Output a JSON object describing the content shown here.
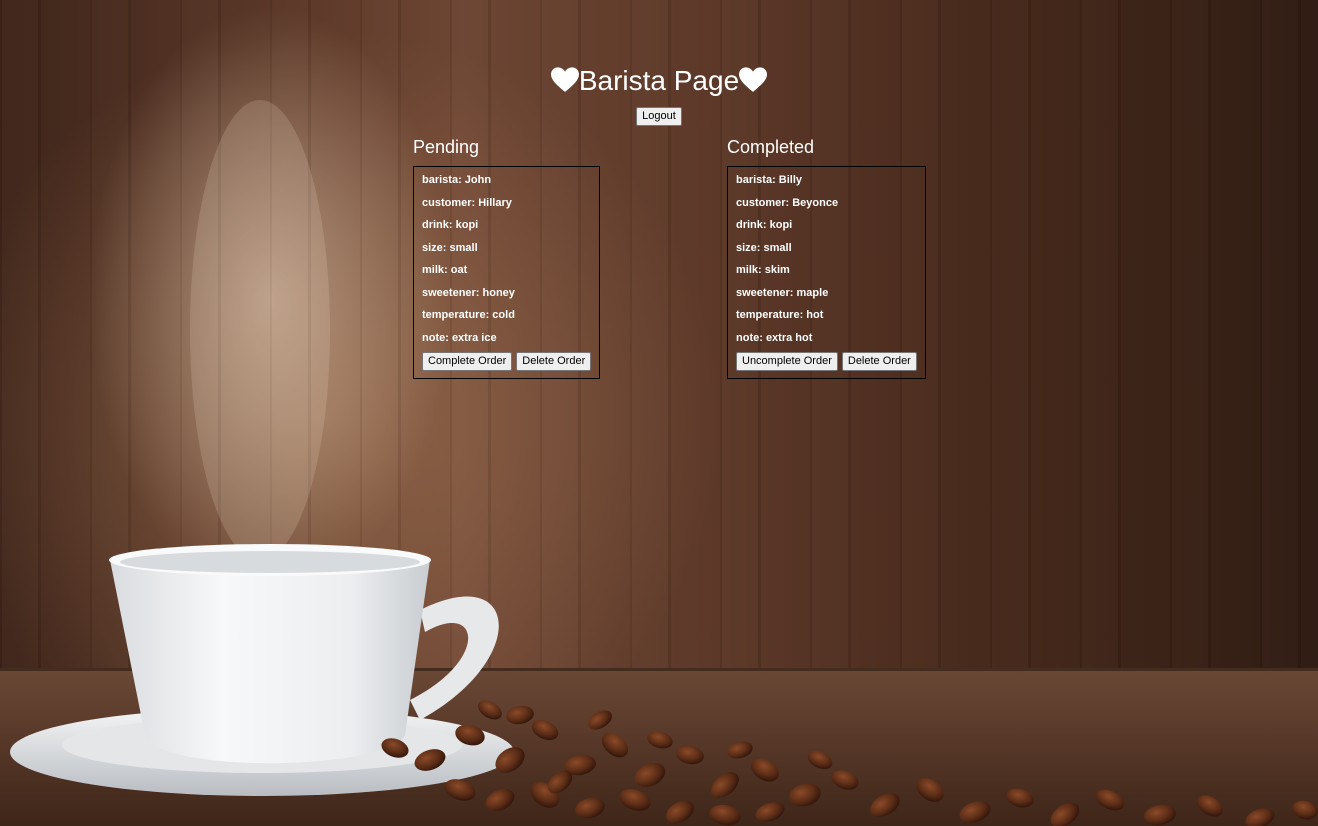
{
  "page": {
    "title": "Barista Page",
    "logout_label": "Logout"
  },
  "pending": {
    "heading": "Pending",
    "order": {
      "barista": "barista: John",
      "customer": "customer: Hillary",
      "drink": "drink: kopi",
      "size": "size: small",
      "milk": "milk: oat",
      "sweetener": "sweetener: honey",
      "temperature": "temperature: cold",
      "note": "note: extra ice"
    },
    "primary_action": "Complete Order",
    "delete_action": "Delete Order"
  },
  "completed": {
    "heading": "Completed",
    "order": {
      "barista": "barista: Billy",
      "customer": "customer: Beyonce",
      "drink": "drink: kopi",
      "size": "size: small",
      "milk": "milk: skim",
      "sweetener": "sweetener: maple",
      "temperature": "temperature: hot",
      "note": "note: extra hot"
    },
    "primary_action": "Uncomplete Order",
    "delete_action": "Delete Order"
  },
  "icons": {
    "title_left": "heart-icon",
    "title_right": "heart-icon"
  },
  "colors": {
    "text": "#ffffff",
    "card_border": "#000000",
    "button_bg": "#efefef"
  }
}
